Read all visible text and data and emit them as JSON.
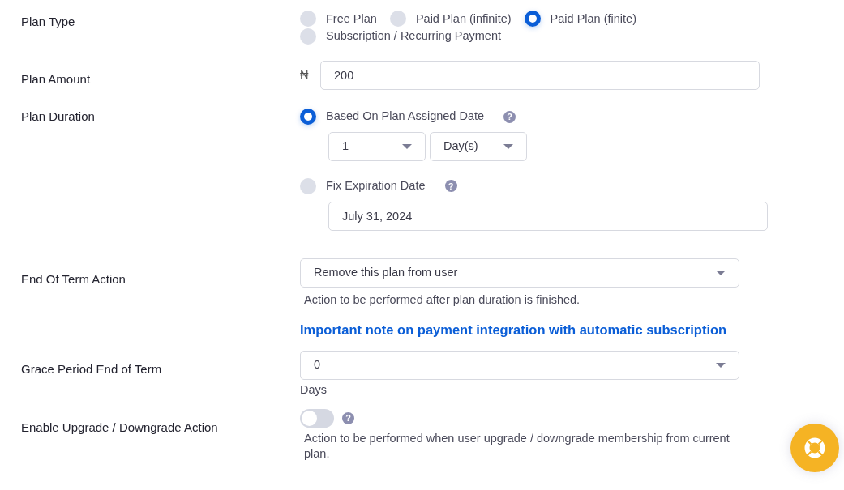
{
  "plan_type": {
    "label": "Plan Type",
    "options": [
      {
        "label": "Free Plan",
        "selected": false
      },
      {
        "label": "Paid Plan (infinite)",
        "selected": false
      },
      {
        "label": "Paid Plan (finite)",
        "selected": true
      },
      {
        "label": "Subscription / Recurring Payment",
        "selected": false
      }
    ]
  },
  "plan_amount": {
    "label": "Plan Amount",
    "currency": "₦",
    "value": "200"
  },
  "plan_duration": {
    "label": "Plan Duration",
    "options": [
      {
        "kind": "relative",
        "label": "Based On Plan Assigned Date",
        "help": "?",
        "selected": true,
        "count": "1",
        "unit": "Day(s)"
      },
      {
        "kind": "fixed",
        "label": "Fix Expiration Date",
        "help": "?",
        "selected": false,
        "date": "July 31, 2024"
      }
    ]
  },
  "end_of_term": {
    "label": "End Of Term Action",
    "value": "Remove this plan from user",
    "hint": "Action to be performed after plan duration is finished.",
    "link": "Important note on payment integration with automatic subscription"
  },
  "grace_period": {
    "label": "Grace Period End of Term",
    "value": "0",
    "unit": "Days"
  },
  "upgrade_action": {
    "label": "Enable Upgrade / Downgrade Action",
    "on": false,
    "help": "?",
    "hint": "Action to be performed when user upgrade / downgrade membership from current plan."
  }
}
